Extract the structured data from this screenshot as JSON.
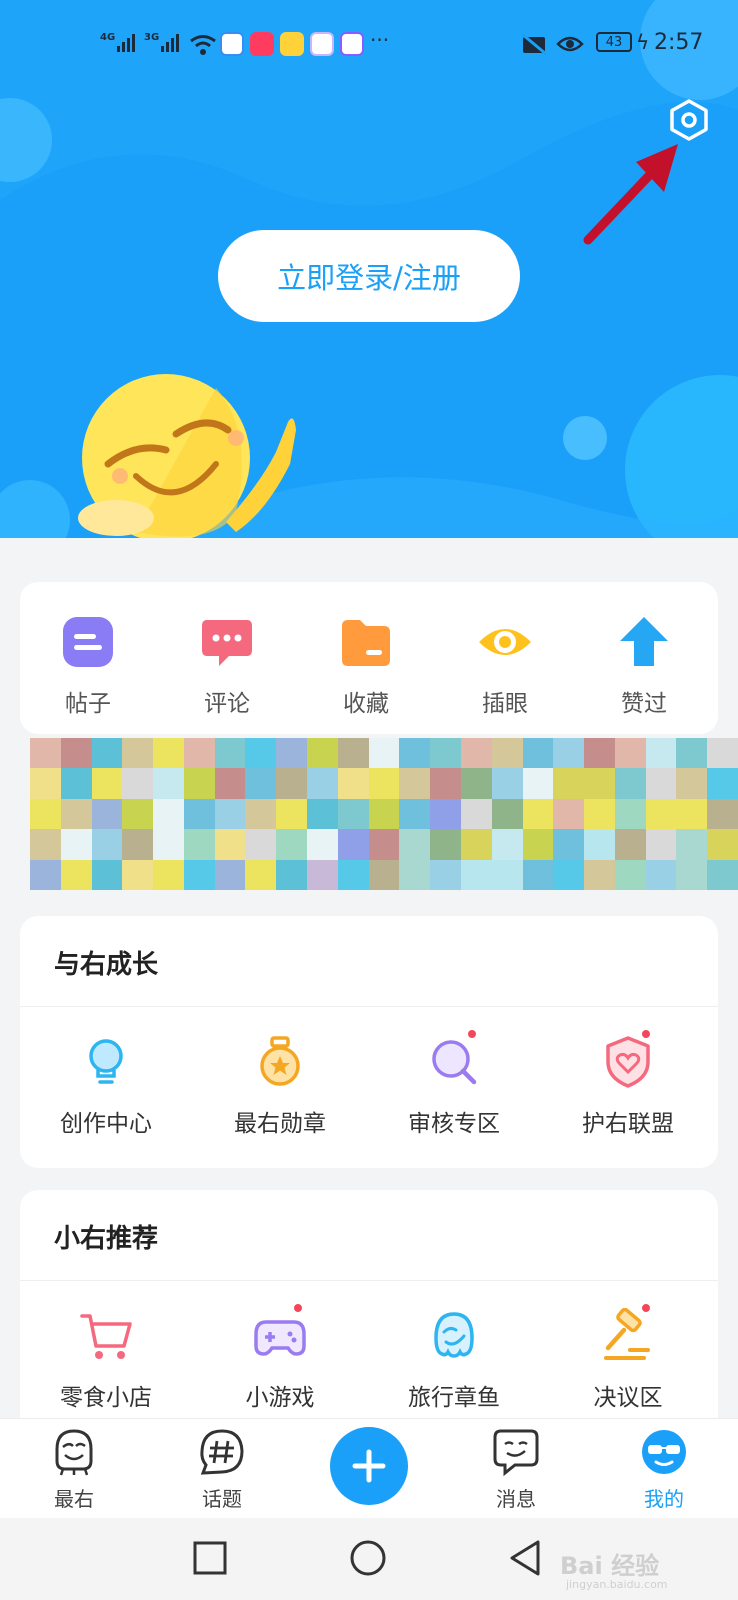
{
  "status_bar": {
    "signal_1_label": "4G",
    "signal_2_label": "3G",
    "battery_level": "43",
    "time": "2:57",
    "more": "···",
    "app_icons": [
      "browser-icon",
      "taobao-icon",
      "banana-app-icon",
      "gallery-icon",
      "qq-icon"
    ]
  },
  "header": {
    "login_label": "立即登录/注册",
    "settings_icon": "settings-hexagon-icon"
  },
  "quick_actions": [
    {
      "label": "帖子",
      "icon": "post-icon",
      "color": "#8a7cf5"
    },
    {
      "label": "评论",
      "icon": "comment-icon",
      "color": "#f5697f"
    },
    {
      "label": "收藏",
      "icon": "folder-icon",
      "color": "#ff9b3d"
    },
    {
      "label": "插眼",
      "icon": "eye-icon",
      "color": "#ffc21d"
    },
    {
      "label": "赞过",
      "icon": "thumb-up-arrow-icon",
      "color": "#26a7f3"
    }
  ],
  "growth": {
    "title": "与右成长",
    "items": [
      {
        "label": "创作中心",
        "icon": "lightbulb-icon",
        "badge": false
      },
      {
        "label": "最右勋章",
        "icon": "medal-icon",
        "badge": false
      },
      {
        "label": "审核专区",
        "icon": "review-search-icon",
        "badge": true
      },
      {
        "label": "护右联盟",
        "icon": "shield-heart-icon",
        "badge": true
      }
    ]
  },
  "recommend": {
    "title": "小右推荐",
    "items": [
      {
        "label": "零食小店",
        "icon": "shopping-cart-icon",
        "badge": false
      },
      {
        "label": "小游戏",
        "icon": "gamepad-icon",
        "badge": true
      },
      {
        "label": "旅行章鱼",
        "icon": "octopus-icon",
        "badge": false
      },
      {
        "label": "决议区",
        "icon": "gavel-icon",
        "badge": true
      }
    ]
  },
  "bottom_nav": {
    "items": [
      {
        "label": "最右",
        "icon": "zuiyou-face-icon",
        "active": false
      },
      {
        "label": "话题",
        "icon": "hashtag-icon",
        "active": false
      },
      {
        "label": "消息",
        "icon": "message-face-icon",
        "active": false
      },
      {
        "label": "我的",
        "icon": "profile-avatar-icon",
        "active": true
      }
    ],
    "fab_icon": "plus-icon"
  },
  "system_nav": {
    "buttons": [
      "recent-apps-icon",
      "home-icon",
      "back-icon"
    ]
  },
  "watermark": {
    "main": "Bai 经验",
    "sub": "jingyan.baidu.com"
  },
  "colors": {
    "brand_blue": "#1aa0f8",
    "background": "#f3f4f6",
    "badge_red": "#f5455c"
  }
}
